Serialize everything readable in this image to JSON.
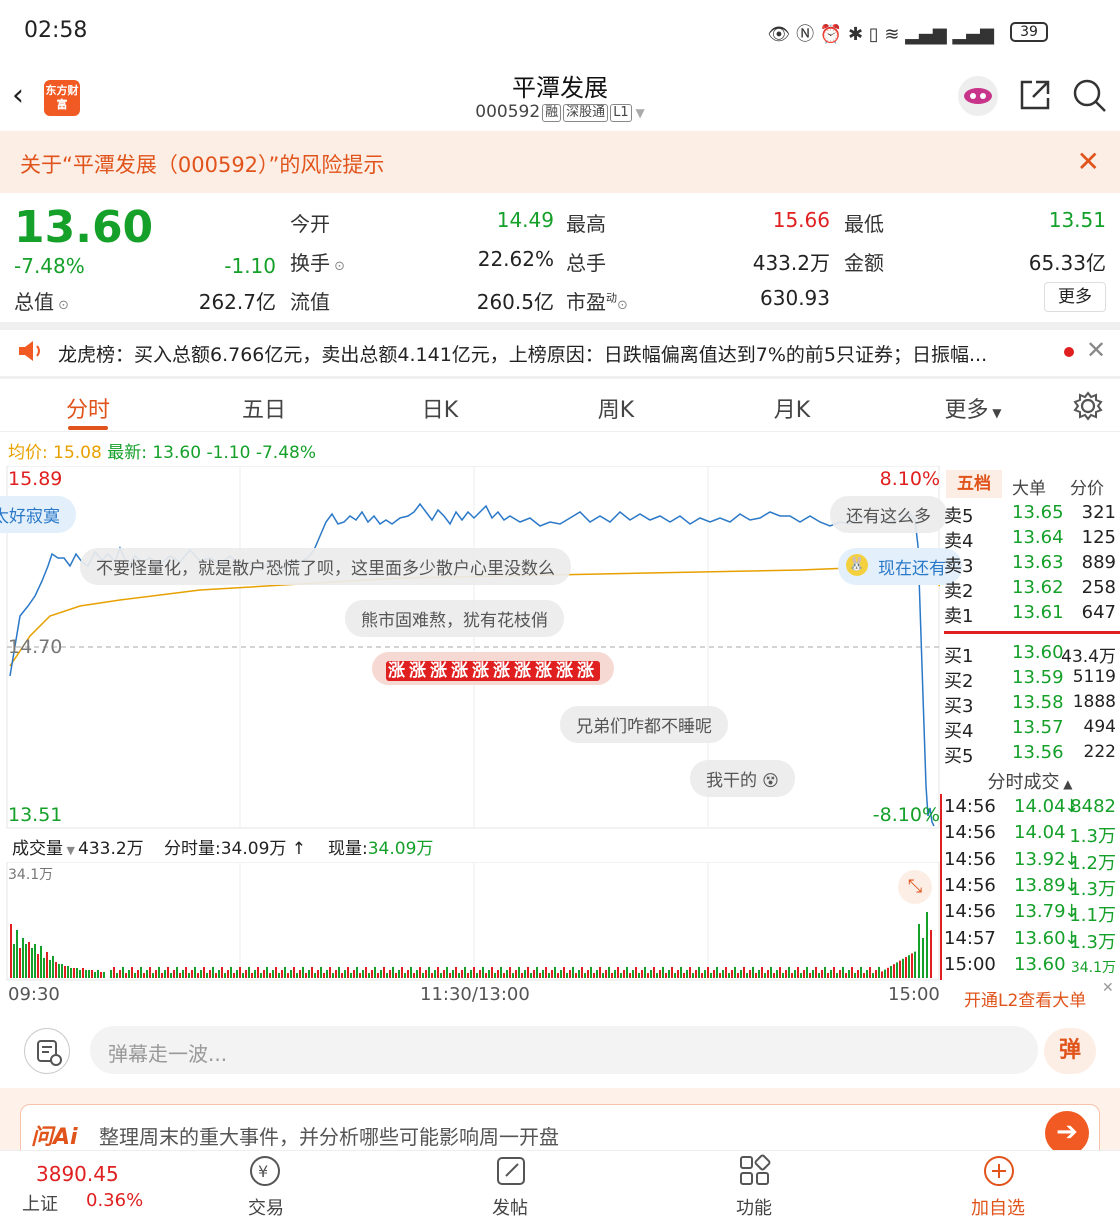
{
  "status": {
    "time": "02:58",
    "battery": "39"
  },
  "header": {
    "title": "平潭发展",
    "code": "000592",
    "tags": [
      "融",
      "深股通",
      "L1"
    ],
    "logo_text": "东方财富"
  },
  "risk_banner": {
    "text": "关于“平潭发展（000592）”的风险提示"
  },
  "quote": {
    "price": "13.60",
    "change_pct": "-7.48%",
    "change": "-1.10",
    "total_value_label": "总值",
    "total_value": "262.7亿",
    "open_label": "今开",
    "open": "14.49",
    "high_label": "最高",
    "high": "15.66",
    "low_label": "最低",
    "low": "13.51",
    "turnover_label": "换手",
    "turnover": "22.62%",
    "volume_label": "总手",
    "volume": "433.2万",
    "amount_label": "金额",
    "amount": "65.33亿",
    "float_label": "流值",
    "float_value": "260.5亿",
    "pe_label": "市盈",
    "pe_sup": "动",
    "pe": "630.93",
    "more": "更多"
  },
  "dragon_tiger": {
    "text": "龙虎榜：买入总额6.766亿元，卖出总额4.141亿元，上榜原因：日跌幅偏离值达到7%的前5只证券；日振幅..."
  },
  "tabs": [
    {
      "label": "分时"
    },
    {
      "label": "五日"
    },
    {
      "label": "日K"
    },
    {
      "label": "周K"
    },
    {
      "label": "月K"
    },
    {
      "label": "更多"
    }
  ],
  "avg_line": {
    "avg_label": "均价:",
    "avg": "15.08",
    "latest_label": "最新:",
    "latest": "13.60",
    "chg": "-1.10",
    "pct": "-7.48%"
  },
  "chart": {
    "top_price": "15.89",
    "mid_price": "14.70",
    "bottom_price": "13.51",
    "top_pct": "8.10%",
    "bottom_pct": "-8.10%"
  },
  "danmaku": [
    {
      "text": "太好寂寞"
    },
    {
      "text": "还有这么多"
    },
    {
      "text": "不要怪量化，就是散户恐慌了呗，这里面多少散户心里没数么"
    },
    {
      "text": "现在还有"
    },
    {
      "text": "熊市固难熬，犹有花枝俏"
    },
    {
      "text": "涨涨涨涨涨涨涨涨涨涨"
    },
    {
      "text": "兄弟们咋都不睡呢"
    },
    {
      "text": "我干的"
    }
  ],
  "volume": {
    "label": "成交量",
    "total": "433.2万",
    "tick_label": "分时量:",
    "tick": "34.09万",
    "now_label": "现量:",
    "now": "34.09万",
    "max": "34.1万"
  },
  "time_axis": {
    "start": "09:30",
    "mid": "11:30/13:00",
    "end": "15:00"
  },
  "orderbook": {
    "tabs": [
      "五档",
      "大单",
      "分价"
    ],
    "asks": [
      {
        "label": "卖5",
        "price": "13.65",
        "vol": "321"
      },
      {
        "label": "卖4",
        "price": "13.64",
        "vol": "125"
      },
      {
        "label": "卖3",
        "price": "13.63",
        "vol": "889"
      },
      {
        "label": "卖2",
        "price": "13.62",
        "vol": "258"
      },
      {
        "label": "卖1",
        "price": "13.61",
        "vol": "647"
      }
    ],
    "bids": [
      {
        "label": "买1",
        "price": "13.60",
        "vol": "43.4万"
      },
      {
        "label": "买2",
        "price": "13.59",
        "vol": "5119"
      },
      {
        "label": "买3",
        "price": "13.58",
        "vol": "1888"
      },
      {
        "label": "买4",
        "price": "13.57",
        "vol": "494"
      },
      {
        "label": "买5",
        "price": "13.56",
        "vol": "222"
      }
    ],
    "ticks_title": "分时成交",
    "ticks": [
      {
        "time": "14:56",
        "price": "14.04",
        "vol": "8482",
        "dir": "↓"
      },
      {
        "time": "14:56",
        "price": "14.04",
        "vol": "1.3万",
        "dir": ""
      },
      {
        "time": "14:56",
        "price": "13.92",
        "vol": "1.2万",
        "dir": "↓"
      },
      {
        "time": "14:56",
        "price": "13.89",
        "vol": "1.3万",
        "dir": "↓"
      },
      {
        "time": "14:56",
        "price": "13.79",
        "vol": "1.1万",
        "dir": "↓"
      },
      {
        "time": "14:57",
        "price": "13.60",
        "vol": "1.3万",
        "dir": "↓"
      },
      {
        "time": "15:00",
        "price": "13.60",
        "vol": "34.1万",
        "dir": ""
      }
    ],
    "l2": "开通L2查看大单"
  },
  "comment": {
    "placeholder": "弹幕走一波...",
    "dan": "弹"
  },
  "ai": {
    "logo": "问Ai",
    "text": "整理周末的重大事件，并分析哪些可能影响周一开盘"
  },
  "nav": {
    "index_value": "3890.45",
    "index_name": "上证",
    "index_pct": "0.36%",
    "items": [
      {
        "label": "交易"
      },
      {
        "label": "发帖"
      },
      {
        "label": "功能"
      },
      {
        "label": "加自选"
      }
    ]
  },
  "colors": {
    "up": "#e02020",
    "down": "#15a02a",
    "accent": "#e0541c",
    "price_line": "#2a78c8",
    "avg_line": "#e8a000"
  }
}
